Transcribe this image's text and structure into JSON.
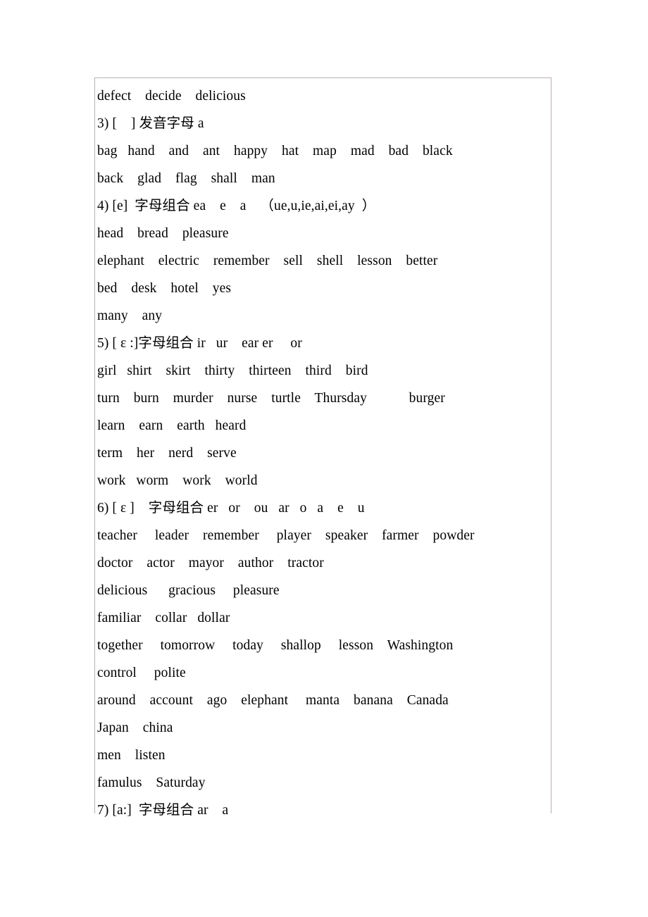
{
  "document": {
    "type": "english-phonics-worksheet",
    "border_color": "#b9b0b8",
    "background": "#ffffff",
    "text_color": "#000000"
  },
  "lines": [
    {
      "id": "line-defect",
      "kind": "wordlist",
      "text": "defect    decide    delicious"
    },
    {
      "id": "line-section-3-heading",
      "kind": "heading",
      "number": "3)",
      "phoneme": "[    ]",
      "cjk": "发音字母",
      "letters": "a",
      "text": "3) [    ] 发音字母 a"
    },
    {
      "id": "line-3-words-1",
      "kind": "wordlist",
      "text": "bag   hand    and    ant    happy    hat    map    mad    bad    black"
    },
    {
      "id": "line-3-words-2",
      "kind": "wordlist",
      "text": "back    glad    flag    shall    man"
    },
    {
      "id": "line-section-4-heading",
      "kind": "heading",
      "number": "4)",
      "phoneme": "[e]",
      "cjk": "字母组合",
      "letters": "ea    e    a",
      "note": "（ue,u,ie,ai,ei,ay  ）",
      "text": "4) [e]  字母组合 ea    e    a    （ue,u,ie,ai,ei,ay  ）"
    },
    {
      "id": "line-4-words-1",
      "kind": "wordlist",
      "text": "head    bread    pleasure"
    },
    {
      "id": "line-4-words-2",
      "kind": "wordlist",
      "text": "elephant    electric    remember    sell    shell    lesson    better"
    },
    {
      "id": "line-4-words-3",
      "kind": "wordlist",
      "text": "bed    desk    hotel    yes"
    },
    {
      "id": "line-4-words-4",
      "kind": "wordlist",
      "text": "many    any"
    },
    {
      "id": "line-section-5-heading",
      "kind": "heading",
      "number": "5)",
      "phoneme": "[ ε :]",
      "cjk": "字母组合",
      "letters": "ir   ur    ear er     or",
      "text": "5) [ ε :]字母组合 ir   ur    ear er     or"
    },
    {
      "id": "line-5-words-1",
      "kind": "wordlist",
      "text": "girl   shirt    skirt    thirty    thirteen    third    bird"
    },
    {
      "id": "line-5-words-2",
      "kind": "wordlist",
      "text": "turn    burn    murder    nurse    turtle    Thursday            burger"
    },
    {
      "id": "line-5-words-3",
      "kind": "wordlist",
      "text": "learn    earn    earth   heard"
    },
    {
      "id": "line-5-words-4",
      "kind": "wordlist",
      "text": "term    her    nerd    serve"
    },
    {
      "id": "line-5-words-5",
      "kind": "wordlist",
      "text": "work   worm    work    world"
    },
    {
      "id": "line-section-6-heading",
      "kind": "heading",
      "number": "6)",
      "phoneme": "[ ε ]",
      "cjk": "字母组合",
      "letters": "er   or    ou   ar   o   a    e    u",
      "text": "6) [ ε ]    字母组合 er   or    ou   ar   o   a    e    u"
    },
    {
      "id": "line-6-words-1",
      "kind": "wordlist",
      "text": "teacher     leader    remember     player    speaker    farmer    powder"
    },
    {
      "id": "line-6-words-2",
      "kind": "wordlist",
      "text": "doctor    actor    mayor    author    tractor"
    },
    {
      "id": "line-6-words-3",
      "kind": "wordlist",
      "text": "delicious      gracious     pleasure"
    },
    {
      "id": "line-6-words-4",
      "kind": "wordlist",
      "text": "familiar    collar   dollar"
    },
    {
      "id": "line-6-words-5",
      "kind": "wordlist",
      "text": "together     tomorrow     today     shallop     lesson    Washington"
    },
    {
      "id": "line-6-words-6",
      "kind": "wordlist",
      "text": "control     polite"
    },
    {
      "id": "line-6-words-7",
      "kind": "wordlist",
      "text": "around    account    ago    elephant     manta    banana    Canada"
    },
    {
      "id": "line-6-words-8",
      "kind": "wordlist",
      "text": "Japan    china"
    },
    {
      "id": "line-6-words-9",
      "kind": "wordlist",
      "text": "men    listen"
    },
    {
      "id": "line-6-words-10",
      "kind": "wordlist",
      "text": "famulus    Saturday"
    },
    {
      "id": "line-section-7-heading",
      "kind": "heading",
      "number": "7)",
      "phoneme": "[a:]",
      "cjk": "字母组合",
      "letters": "ar    a",
      "text": "7) [a:]  字母组合 ar    a"
    }
  ]
}
